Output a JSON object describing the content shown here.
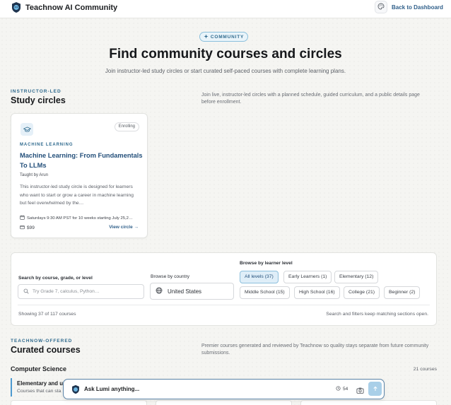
{
  "header": {
    "app_title": "Teachnow AI Community",
    "palette_icon": "palette-icon",
    "back_label": "Back to Dashboard"
  },
  "hero": {
    "pill_label": "COMMUNITY",
    "title": "Find community courses and circles",
    "subtitle": "Join instructor-led study circles or start curated self-paced courses with complete learning plans."
  },
  "study_circles": {
    "eyebrow": "INSTRUCTOR-LED",
    "title": "Study circles",
    "description": "Join live, instructor-led circles with a planned schedule, guided curriculum, and a public details page before enrollment.",
    "cards": [
      {
        "icon": "graduation-cap-icon",
        "badge": "Enrolling",
        "category": "MACHINE LEARNING",
        "title": "Machine Learning: From Fundamentals To LLMs",
        "teacher": "Taught by Arun",
        "description": "This instructor-led study circle is designed for learners who want to start or grow a career in machine learning but feel overwhelmed by the…",
        "schedule": "Saturdays 9:30 AM PST for 10 weeks starting July 25,2…",
        "price": "$99",
        "view_label": "View circle →"
      }
    ]
  },
  "filters": {
    "search_label": "Search by course, grade, or level",
    "search_placeholder": "Try Grade 7, calculus, Python…",
    "country_label": "Browse by country",
    "country_value": "United States",
    "level_label": "Browse by learner level",
    "levels": [
      {
        "label": "All levels (37)",
        "active": true
      },
      {
        "label": "Early Learners (1)",
        "active": false
      },
      {
        "label": "Elementary (12)",
        "active": false
      },
      {
        "label": "Middle School (15)",
        "active": false
      },
      {
        "label": "High School (16)",
        "active": false
      },
      {
        "label": "College (21)",
        "active": false
      },
      {
        "label": "Beginner (2)",
        "active": false
      }
    ],
    "count_text": "Showing 37 of 117 courses",
    "note_text": "Search and filters keep matching sections open."
  },
  "curated": {
    "eyebrow": "TEACHNOW-OFFERED",
    "title": "Curated courses",
    "description": "Premier courses generated and reviewed by Teachnow so quality stays separate from future community submissions.",
    "subject": "Computer Science",
    "subject_count": "21 courses",
    "level_title": "Elementary and u",
    "level_subtitle": "Courses that can sta"
  },
  "assistant": {
    "prompt": "Ask Lumi anything...",
    "credits": "54"
  },
  "colors": {
    "accent": "#2f6a8e",
    "link": "#2f5f8a",
    "active_chip_bg": "#dfeef8"
  }
}
